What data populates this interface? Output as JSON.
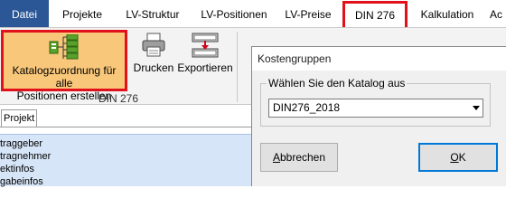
{
  "ribbon_tabs": [
    {
      "label": "Datei"
    },
    {
      "label": "Projekte"
    },
    {
      "label": "LV-Struktur"
    },
    {
      "label": "LV-Positionen"
    },
    {
      "label": "LV-Preise"
    },
    {
      "label": "DIN 276"
    },
    {
      "label": "Kalkulation"
    },
    {
      "label": "Ac"
    }
  ],
  "ribbon": {
    "catalog_button": {
      "line1": "Katalogzuordnung für alle",
      "line2": "Positionen erstellen"
    },
    "print_button": "Drucken",
    "export_button": "Exportieren",
    "group_label": "DIN 276"
  },
  "left_panel": {
    "tab_label": "Projekt",
    "rows": [
      "traggeber",
      "tragnehmer",
      "ektinfos",
      "gabeinfos"
    ]
  },
  "dialog": {
    "title": "Kostengruppen",
    "group_label": "Wählen Sie den Katalog aus",
    "select_value": "DIN276_2018",
    "cancel_prefix": "",
    "cancel_mnemonic": "A",
    "cancel_rest": "bbrechen",
    "ok_mnemonic": "O",
    "ok_rest": "K"
  },
  "colors": {
    "file_tab_bg": "#2b5797",
    "highlight_border": "#e0111a",
    "catalog_button_bg": "#f8c77a",
    "list_bg": "#d6e5f7"
  }
}
